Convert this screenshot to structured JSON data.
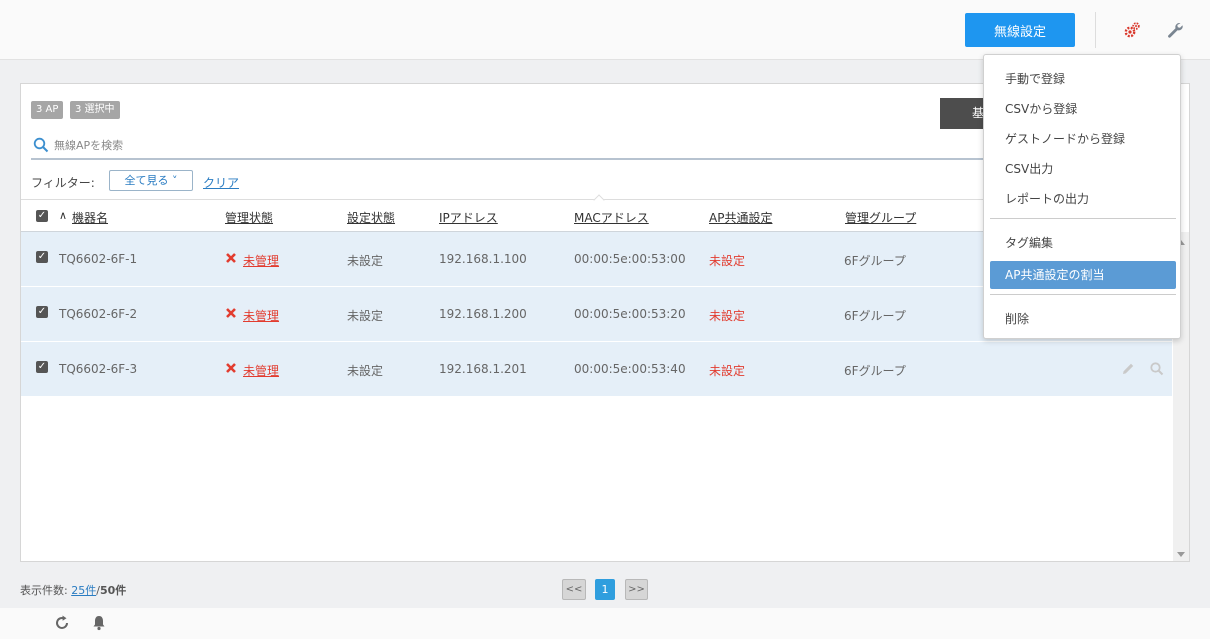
{
  "header": {
    "wireless_button": "無線設定",
    "gear_icon": "gears-icon",
    "wrench_icon": "wrench-icon"
  },
  "panel": {
    "ap_count_badge": "3 AP",
    "selected_badge": "3 選択中",
    "dark_button_partial": "基",
    "search": {
      "placeholder": "無線APを検索",
      "value": ""
    },
    "filter": {
      "label": "フィルター:",
      "select_value": "全て見る ˅",
      "clear": "クリア"
    }
  },
  "table": {
    "columns": [
      "機器名",
      "管理状態",
      "設定状態",
      "IPアドレス",
      "MACアドレス",
      "AP共通設定",
      "管理グループ"
    ],
    "sort_indicator": "∧",
    "rows": [
      {
        "name": "TQ6602-6F-1",
        "mgmt": "未管理",
        "config": "未設定",
        "ip": "192.168.1.100",
        "mac": "00:00:5e:00:53:00",
        "ap_common": "未設定",
        "group": "6Fグループ"
      },
      {
        "name": "TQ6602-6F-2",
        "mgmt": "未管理",
        "config": "未設定",
        "ip": "192.168.1.200",
        "mac": "00:00:5e:00:53:20",
        "ap_common": "未設定",
        "group": "6Fグループ"
      },
      {
        "name": "TQ6602-6F-3",
        "mgmt": "未管理",
        "config": "未設定",
        "ip": "192.168.1.201",
        "mac": "00:00:5e:00:53:40",
        "ap_common": "未設定",
        "group": "6Fグループ"
      }
    ]
  },
  "footer": {
    "count_label": "表示件数:",
    "per_page": "25件",
    "separator": "/",
    "total": "50件",
    "pager": {
      "prev": "<<",
      "current": "1",
      "next": ">>"
    }
  },
  "menu": {
    "items": [
      "手動で登録",
      "CSVから登録",
      "ゲストノードから登録",
      "CSV出力",
      "レポートの出力",
      "タグ編集",
      "AP共通設定の割当",
      "削除"
    ],
    "active_item": "AP共通設定の割当"
  },
  "colors": {
    "primary": "#1e96f0",
    "error": "#e23c2f",
    "row_selected": "#e5eff8",
    "menu_active": "#5b9bd5",
    "link": "#2a7cc2"
  }
}
